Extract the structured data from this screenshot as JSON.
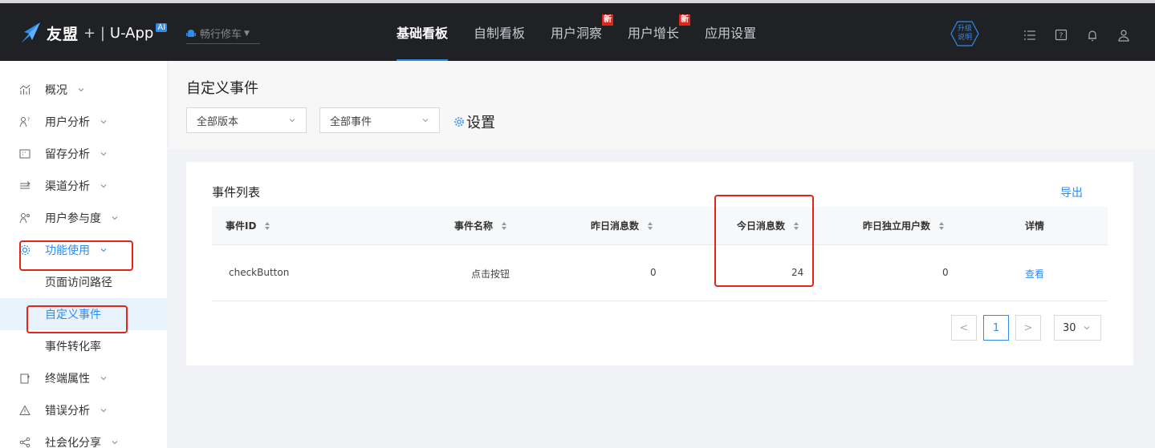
{
  "header": {
    "logo_text": "友盟",
    "logo_plus": "+",
    "logo_app": "U-App",
    "ai_badge": "AI",
    "app_name": "畅行修车",
    "nav": [
      {
        "label": "基础看板",
        "active": true,
        "badge": ""
      },
      {
        "label": "自制看板",
        "active": false,
        "badge": ""
      },
      {
        "label": "用户洞察",
        "active": false,
        "badge": "新"
      },
      {
        "label": "用户增长",
        "active": false,
        "badge": "新"
      },
      {
        "label": "应用设置",
        "active": false,
        "badge": ""
      }
    ],
    "upgrade_line1": "升级",
    "upgrade_line2": "说明"
  },
  "sidebar": {
    "items": [
      {
        "label": "概况",
        "icon": "overview-icon"
      },
      {
        "label": "用户分析",
        "icon": "user-analysis-icon"
      },
      {
        "label": "留存分析",
        "icon": "retention-icon"
      },
      {
        "label": "渠道分析",
        "icon": "channel-icon"
      },
      {
        "label": "用户参与度",
        "icon": "engagement-icon"
      },
      {
        "label": "功能使用",
        "icon": "feature-icon"
      },
      {
        "label": "页面访问路径",
        "icon": ""
      },
      {
        "label": "自定义事件",
        "icon": ""
      },
      {
        "label": "事件转化率",
        "icon": ""
      },
      {
        "label": "终端属性",
        "icon": "device-icon"
      },
      {
        "label": "错误分析",
        "icon": "error-icon"
      },
      {
        "label": "社会化分享",
        "icon": "share-icon"
      }
    ]
  },
  "page": {
    "title": "自定义事件",
    "version_select": "全部版本",
    "event_select": "全部事件",
    "settings_label": "设置"
  },
  "table": {
    "title": "事件列表",
    "export_label": "导出",
    "columns": [
      "事件ID",
      "事件名称",
      "昨日消息数",
      "今日消息数",
      "昨日独立用户数",
      "详情"
    ],
    "rows": [
      {
        "event_id": "checkButton",
        "event_name": "点击按钮",
        "yesterday_msgs": "0",
        "today_msgs": "24",
        "yesterday_users": "0",
        "detail": "查看"
      }
    ]
  },
  "pagination": {
    "prev": "<",
    "current": "1",
    "next": ">",
    "page_size": "30"
  },
  "colors": {
    "accent": "#2d8cf0",
    "header_bg": "#1f2124",
    "highlight": "#e1251b"
  }
}
